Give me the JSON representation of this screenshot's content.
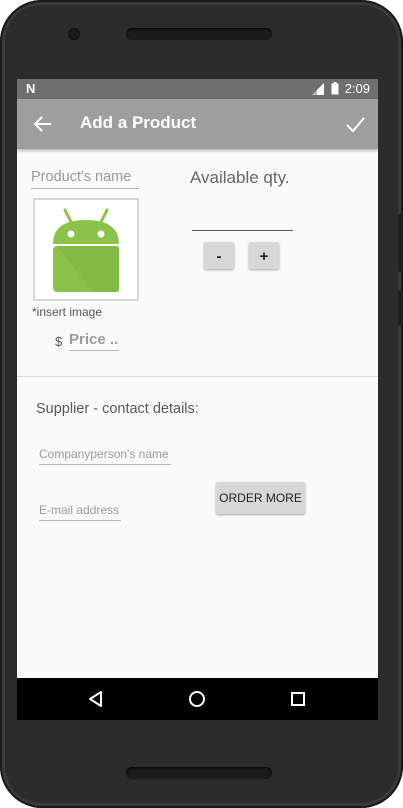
{
  "status_bar": {
    "notification_icon": "N",
    "time": "2:09"
  },
  "app_bar": {
    "title": "Add a Product",
    "back_icon": "arrow-left",
    "confirm_icon": "check"
  },
  "product": {
    "name_placeholder": "Product's name",
    "image_hint": "*insert image",
    "currency_symbol": "$",
    "price_placeholder": "Price ..",
    "available_qty_label": "Available qty.",
    "minus_label": "-",
    "plus_label": "+"
  },
  "supplier": {
    "title": "Supplier - contact details:",
    "company_placeholder": "Companyperson's name",
    "email_placeholder": "E-mail address",
    "order_button": "ORDER MORE"
  },
  "colors": {
    "app_bar": "#9e9e9e",
    "status_bar": "#6f6f6f",
    "android_green": "#8bc34a"
  }
}
